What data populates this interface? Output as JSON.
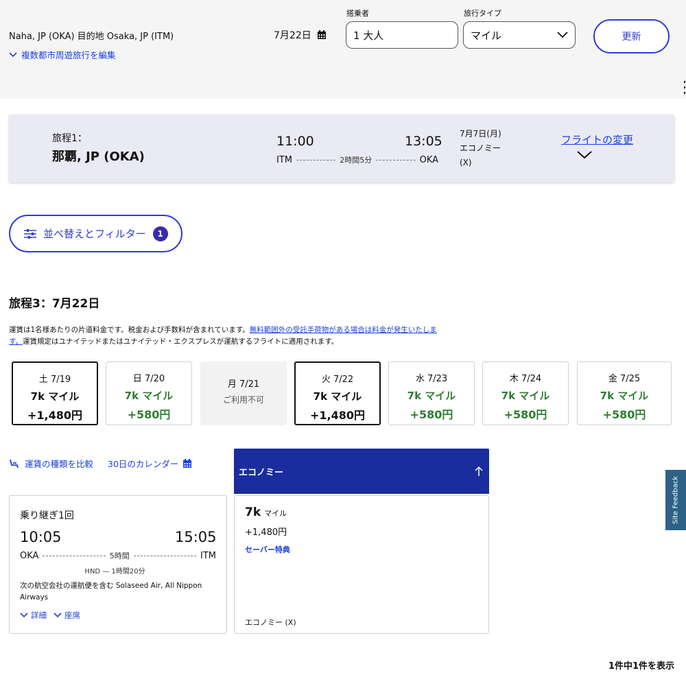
{
  "header": {
    "route": "Naha, JP (OKA) 目的地 Osaka, JP (ITM)",
    "edit_multicity": "複数都市周遊旅行を編集",
    "date": "7月22日",
    "passengers_label": "搭乗者",
    "passengers_value": "1 大人",
    "trip_type_label": "旅行タイプ",
    "trip_type_value": "マイル",
    "update_button": "更新"
  },
  "itinerary1": {
    "label": "旅程1：",
    "city": "那覇, JP (OKA)",
    "depart_time": "11:00",
    "arrive_time": "13:05",
    "from": "ITM",
    "to": "OKA",
    "duration": "2時間5分",
    "date": "7月7日(月)",
    "cabin": "エコノミー",
    "cabin_code": "(X)",
    "change_link": "フライトの変更"
  },
  "filter": {
    "label": "並べ替えとフィルター",
    "count": "1"
  },
  "itinerary3": {
    "title": "旅程3：7月22日",
    "note_prefix": "運賃は1名様あたりの片道料金です。税金および手数料が含まれています。",
    "note_link_1": "無料範囲外の受託手荷物がある場合は料金が発生いたしま",
    "note_link_2": "す。",
    "note_suffix": "運賃規定はユナイテッドまたはユナイテッド・エクスプレスが運航するフライトに適用されます。"
  },
  "dates": [
    {
      "day": "土 7/19",
      "miles": "7k マイル",
      "price": "+1,480円"
    },
    {
      "day": "日 7/20",
      "miles": "7k マイル",
      "price": "+580円"
    },
    {
      "day": "月 7/21",
      "unavailable": "ご利用不可"
    },
    {
      "day": "火 7/22",
      "miles": "7k マイル",
      "price": "+1,480円"
    },
    {
      "day": "水 7/23",
      "miles": "7k マイル",
      "price": "+580円"
    },
    {
      "day": "木 7/24",
      "miles": "7k マイル",
      "price": "+580円"
    },
    {
      "day": "金 7/25",
      "miles": "7k マイル",
      "price": "+580円"
    }
  ],
  "tools": {
    "compare": "運賃の種類を比較",
    "calendar": "30日のカレンダー"
  },
  "result": {
    "stops": "乗り継ぎ1回",
    "depart_time": "10:05",
    "arrive_time": "15:05",
    "from": "OKA",
    "to": "ITM",
    "duration": "5時間",
    "layover": "HND — 1時間20分",
    "operated_by": "次の航空会社の運航便を含む Solaseed Air, All Nippon Airways",
    "details": "詳細",
    "seats": "座席"
  },
  "economy": {
    "header": "エコノミー",
    "miles": "7k",
    "miles_unit": "マイル",
    "price": "+1,480円",
    "saver": "セーバー特典",
    "cabin": "エコノミー (X)"
  },
  "footer": {
    "count": "1件中1件を表示"
  },
  "feedback": "Site Feedback",
  "colors": {
    "accent": "#2f3bd1",
    "economy_header": "#1a2d9c",
    "green_price": "#2e7d32",
    "card_bg": "#e9eaf3"
  }
}
